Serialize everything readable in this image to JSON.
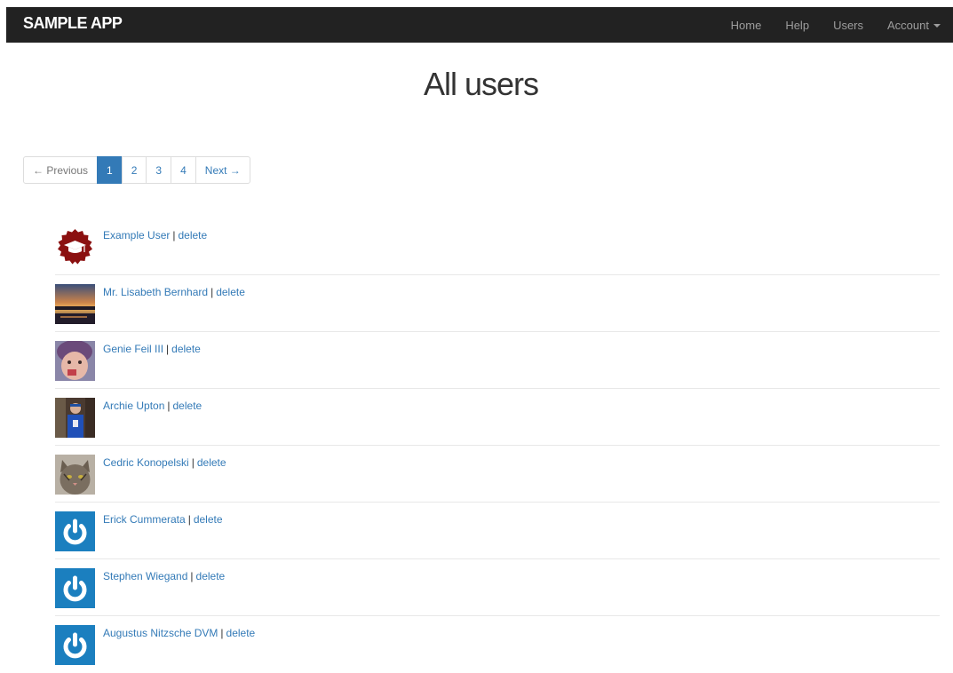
{
  "navbar": {
    "brand": "SAMPLE APP",
    "links": [
      "Home",
      "Help",
      "Users",
      "Account"
    ]
  },
  "page": {
    "title": "All users"
  },
  "pagination": {
    "previous": "← Previous",
    "pages": [
      "1",
      "2",
      "3",
      "4"
    ],
    "next": "Next →",
    "current_page": "1"
  },
  "users": [
    {
      "name": "Example User",
      "delete_label": "delete",
      "separator": "|",
      "avatar": "graduation-badge"
    },
    {
      "name": "Mr. Lisabeth Bernhard",
      "delete_label": "delete",
      "separator": "|",
      "avatar": "sunset-photo"
    },
    {
      "name": "Genie Feil III",
      "delete_label": "delete",
      "separator": "|",
      "avatar": "child-photo"
    },
    {
      "name": "Archie Upton",
      "delete_label": "delete",
      "separator": "|",
      "avatar": "person-photo"
    },
    {
      "name": "Cedric Konopelski",
      "delete_label": "delete",
      "separator": "|",
      "avatar": "cat-photo"
    },
    {
      "name": "Erick Cummerata",
      "delete_label": "delete",
      "separator": "|",
      "avatar": "power-icon"
    },
    {
      "name": "Stephen Wiegand",
      "delete_label": "delete",
      "separator": "|",
      "avatar": "power-icon"
    },
    {
      "name": "Augustus Nitzsche DVM",
      "delete_label": "delete",
      "separator": "|",
      "avatar": "power-icon"
    }
  ],
  "colors": {
    "navbar_bg": "#222222",
    "link": "#337ab7",
    "active_page_bg": "#337ab7",
    "default_avatar_bg": "#1b7fbf",
    "badge_red": "#8b1010"
  }
}
